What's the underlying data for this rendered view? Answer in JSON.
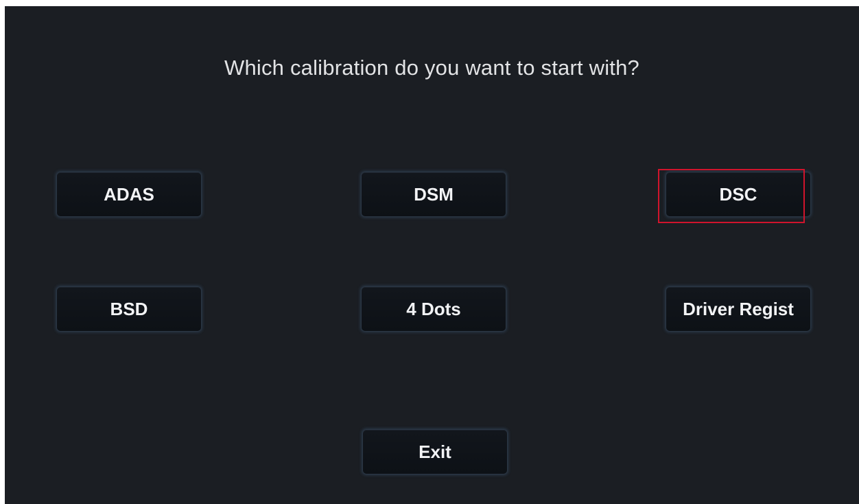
{
  "dialog": {
    "title": "Which calibration do you want to start with?"
  },
  "buttons": {
    "adas": "ADAS",
    "dsm": "DSM",
    "dsc": "DSC",
    "bsd": "BSD",
    "four_dots": "4 Dots",
    "driver_regist": "Driver Regist",
    "exit": "Exit"
  },
  "colors": {
    "background": "#1b1e23",
    "button_fill": "#0f1318",
    "button_glow": "#2b3644",
    "highlight": "#d0142c"
  }
}
